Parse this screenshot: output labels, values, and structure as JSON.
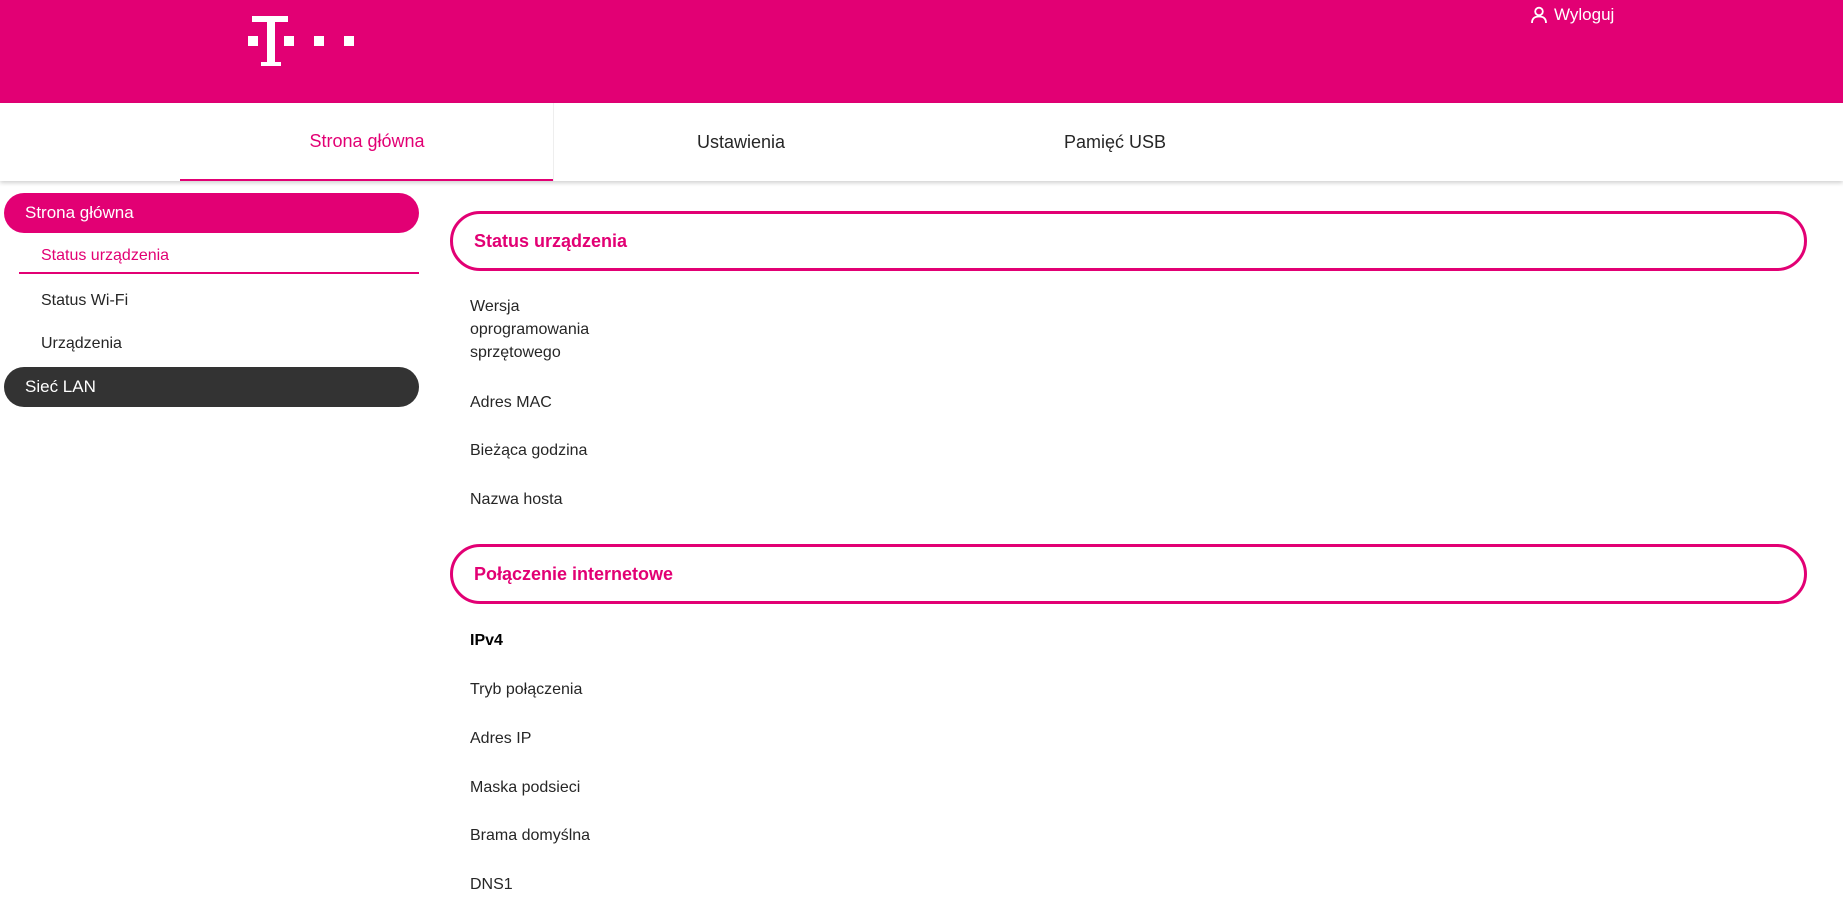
{
  "header": {
    "logout_label": "Wyloguj",
    "brand_color": "#e20074"
  },
  "tabs": [
    {
      "label": "Strona główna",
      "active": true
    },
    {
      "label": "Ustawienia",
      "active": false
    },
    {
      "label": "Pamięć USB",
      "active": false
    }
  ],
  "sidebar": {
    "home": "Strona główna",
    "items": [
      {
        "label": "Status urządzenia",
        "active": true
      },
      {
        "label": "Status Wi-Fi",
        "active": false
      },
      {
        "label": "Urządzenia",
        "active": false
      }
    ],
    "lan": "Sieć LAN"
  },
  "sections": [
    {
      "title": "Status urządzenia",
      "rows": [
        "Wersja\noprogramowania\nsprzętowego",
        "Adres MAC",
        "Bieżąca godzina",
        "Nazwa hosta"
      ]
    },
    {
      "title": "Połączenie internetowe",
      "subheading": "IPv4",
      "rows": [
        "Tryb połączenia",
        "Adres IP",
        "Maska podsieci",
        "Brama domyślna",
        "DNS1"
      ]
    }
  ]
}
